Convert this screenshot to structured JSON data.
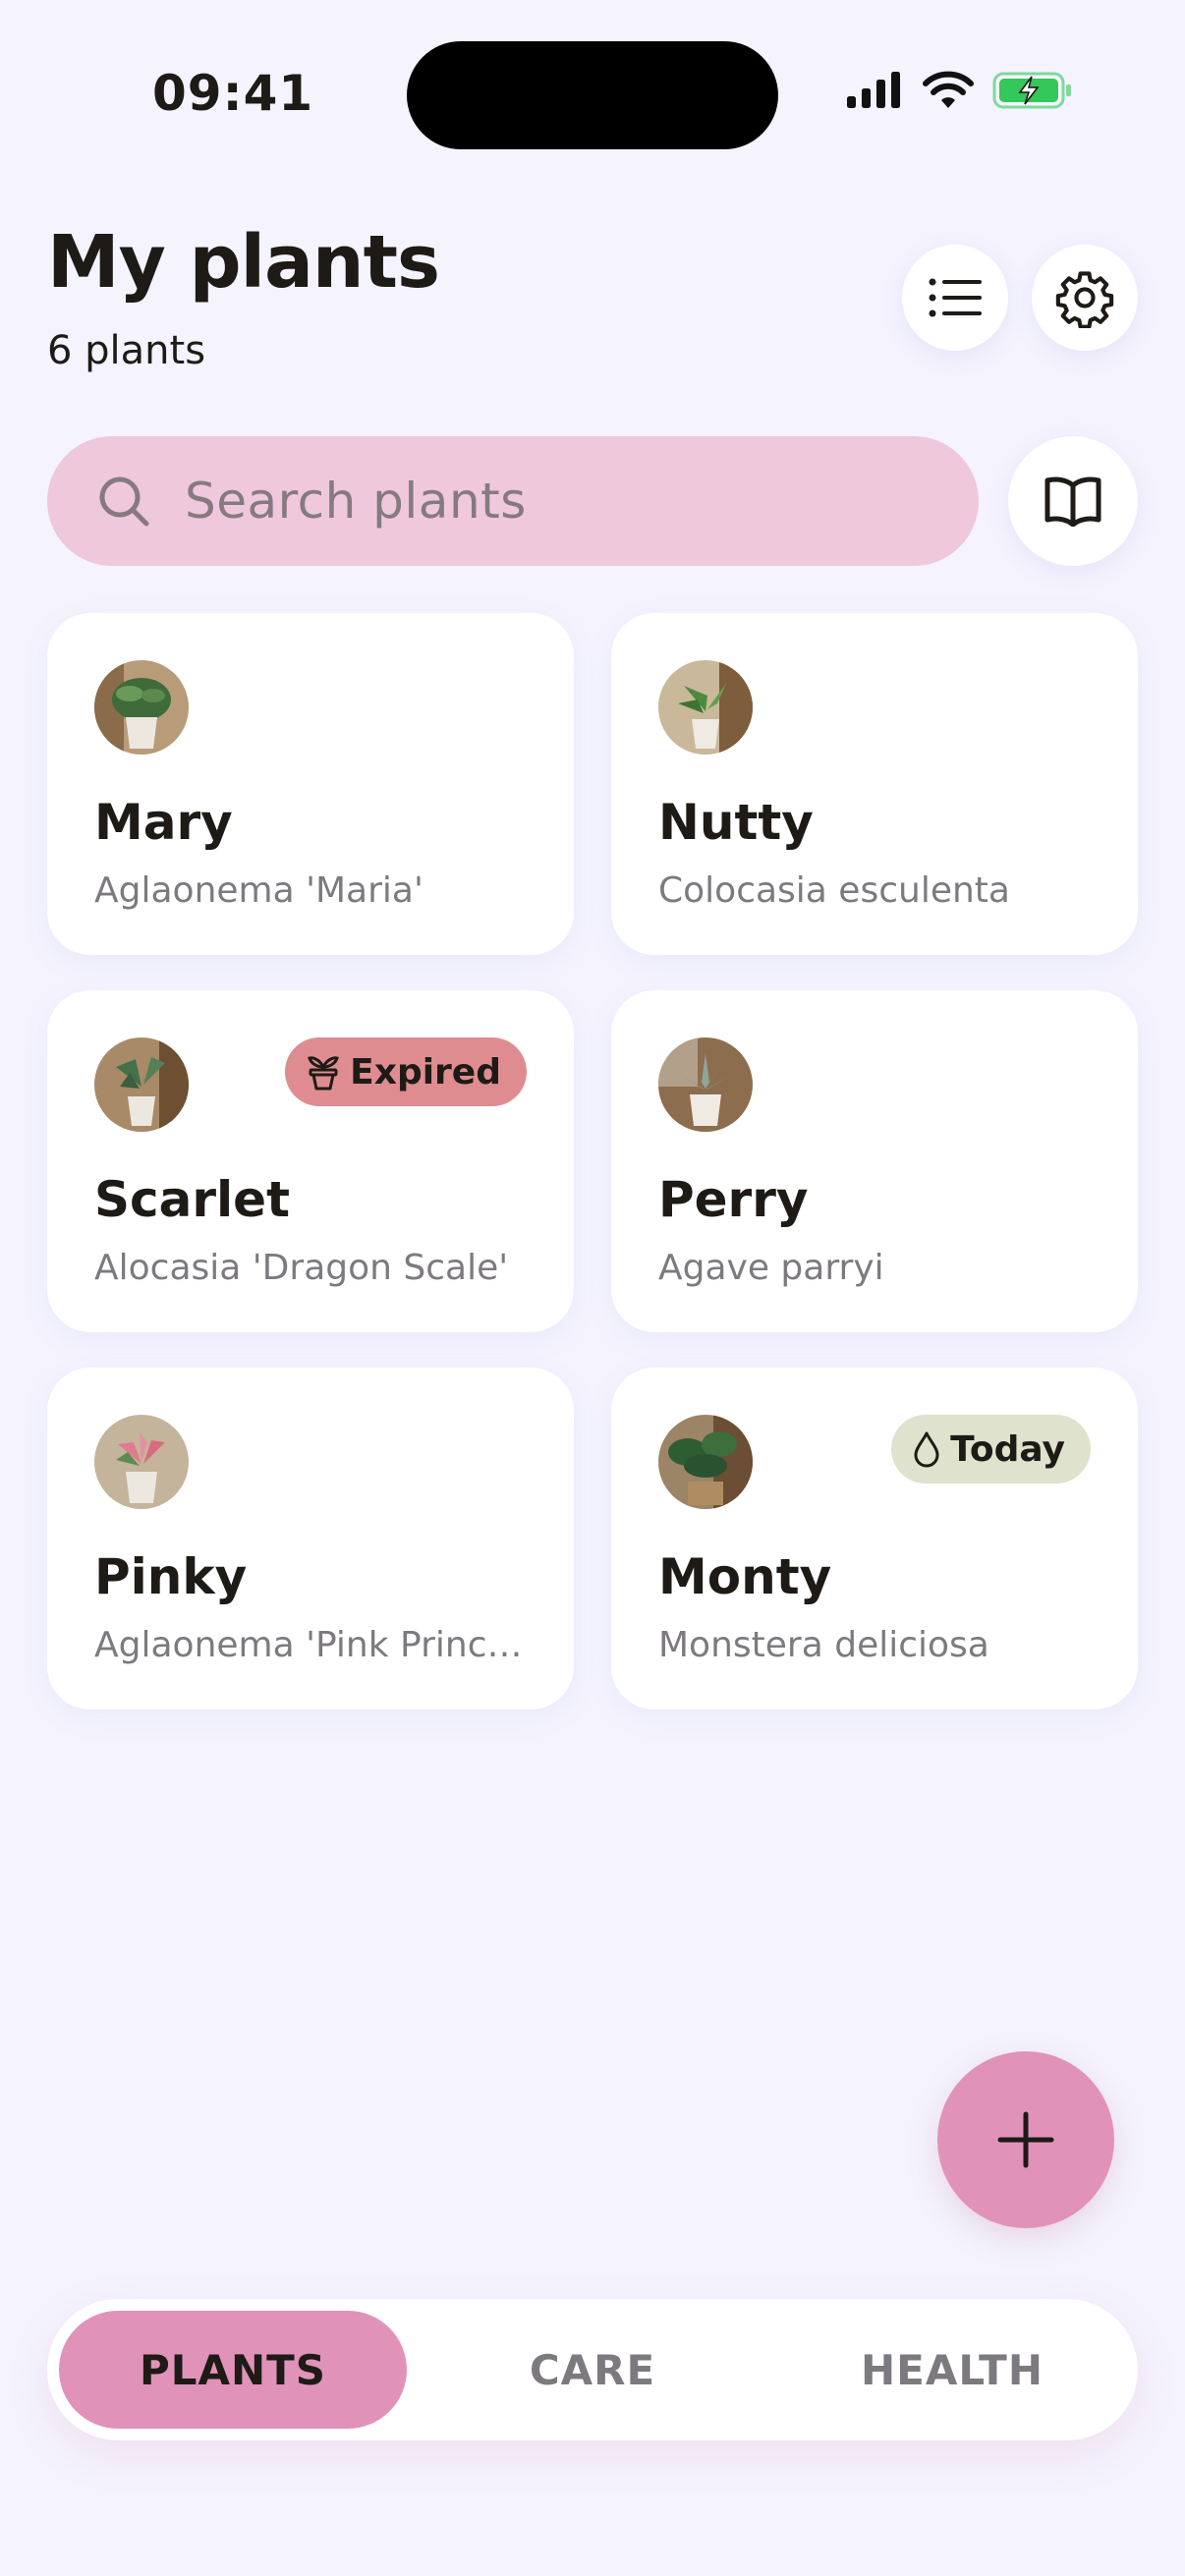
{
  "status_bar": {
    "time": "09:41"
  },
  "header": {
    "title": "My plants",
    "subtitle": "6 plants"
  },
  "search": {
    "placeholder": "Search plants"
  },
  "plants": [
    {
      "name": "Mary",
      "species": "Aglaonema 'Maria'",
      "badge": null
    },
    {
      "name": "Nutty",
      "species": "Colocasia esculenta",
      "badge": null
    },
    {
      "name": "Scarlet",
      "species": "Alocasia 'Dragon Scale'",
      "badge": {
        "label": "Expired",
        "icon": "pot-icon",
        "color": "#df8c91"
      }
    },
    {
      "name": "Perry",
      "species": "Agave parryi",
      "badge": null
    },
    {
      "name": "Pinky",
      "species": "Aglaonema 'Pink Princ…",
      "badge": null
    },
    {
      "name": "Monty",
      "species": "Monstera deliciosa",
      "badge": {
        "label": "Today",
        "icon": "water-drop-icon",
        "color": "#dfe2cc"
      }
    }
  ],
  "nav": {
    "tabs": [
      "PLANTS",
      "CARE",
      "HEALTH"
    ],
    "active": "PLANTS"
  },
  "colors": {
    "background": "#f4f3fe",
    "accent": "#e192b8",
    "search_fill": "#efc8dc",
    "battery": "#34c759"
  }
}
